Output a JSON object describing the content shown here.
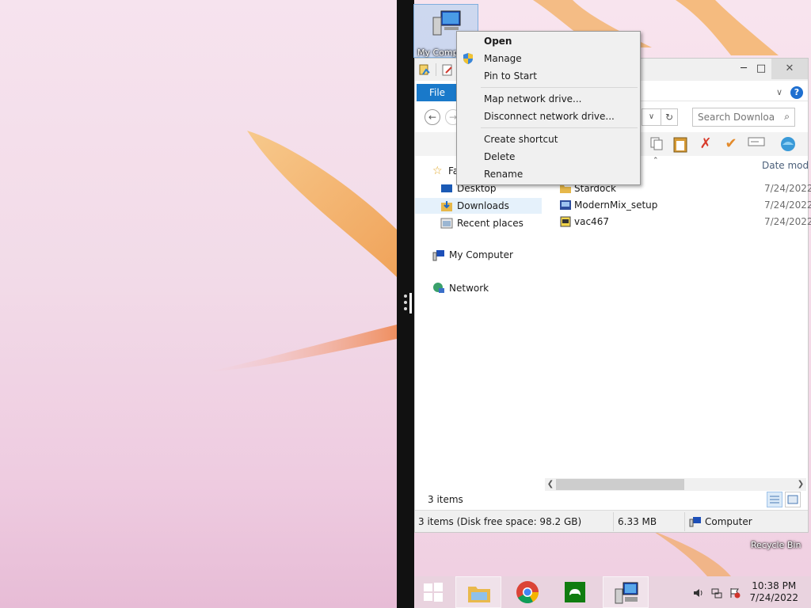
{
  "desktop": {
    "icons": [
      {
        "label": "My Computer",
        "visible_label": "My Comp"
      },
      {
        "label": "Recycle Bin"
      }
    ]
  },
  "context_menu": {
    "items": [
      {
        "label": "Open",
        "default": true
      },
      {
        "label": "Manage",
        "icon": "uac-shield-icon"
      },
      {
        "label": "Pin to Start"
      },
      {
        "label": "Map network drive..."
      },
      {
        "label": "Disconnect network drive..."
      },
      {
        "label": "Create shortcut"
      },
      {
        "label": "Delete"
      },
      {
        "label": "Rename"
      }
    ]
  },
  "explorer": {
    "ribbon": {
      "file_tab": "File"
    },
    "search": {
      "placeholder": "Search Downloa..."
    },
    "nav_pane": {
      "favorites_label": "Fa",
      "items": [
        {
          "label": "Desktop"
        },
        {
          "label": "Downloads",
          "selected": true
        },
        {
          "label": "Recent places"
        },
        {
          "label": "My Computer"
        },
        {
          "label": "Network"
        }
      ]
    },
    "file_list": {
      "column_date": "Date mod",
      "rows": [
        {
          "name": "Stardock",
          "date": "7/24/2022",
          "icon": "folder-icon"
        },
        {
          "name": "ModernMix_setup",
          "date": "7/24/2022",
          "icon": "installer-icon"
        },
        {
          "name": "vac467",
          "date": "7/24/2022",
          "icon": "app-icon"
        }
      ]
    },
    "item_count": "3 items",
    "status": {
      "disk": "3 items (Disk free space: 98.2 GB)",
      "size": "6.33 MB",
      "location": "Computer"
    }
  },
  "taskbar": {
    "clock_time": "10:38 PM",
    "clock_date": "7/24/2022"
  },
  "colors": {
    "accent": "#1979ca",
    "menu_bg": "#f0f0f0",
    "divider": "#111111"
  }
}
